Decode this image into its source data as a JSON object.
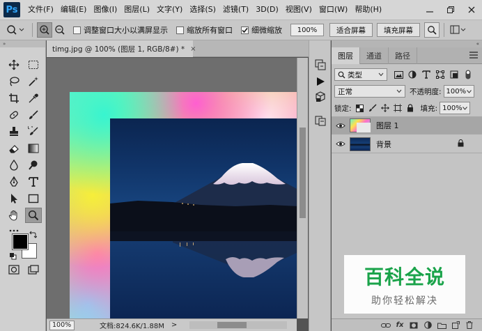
{
  "app": {
    "logo": "Ps"
  },
  "menu": [
    "文件(F)",
    "编辑(E)",
    "图像(I)",
    "图层(L)",
    "文字(Y)",
    "选择(S)",
    "滤镜(T)",
    "3D(D)",
    "视图(V)",
    "窗口(W)",
    "帮助(H)"
  ],
  "window_controls": {
    "minimize": "minimize-icon",
    "restore": "restore-icon",
    "close": "close-icon"
  },
  "options": {
    "resize_windows": "调整窗口大小以满屏显示",
    "zoom_all_windows": "缩放所有窗口",
    "scrubby_zoom": "细微缩放",
    "scrubby_zoom_checked": true,
    "zoom_value": "100%",
    "fit_screen": "适合屏幕",
    "fill_screen": "填充屏幕"
  },
  "document": {
    "tab_title": "timg.jpg @ 100% (图层 1, RGB/8#) *",
    "close_glyph": "×",
    "zoom": "100%",
    "doc_info": "文档:824.6K/1.88M",
    "status_arrow": ">"
  },
  "toolbar": {
    "head": "» ",
    "colors": {
      "foreground": "#000000",
      "background": "#ffffff"
    }
  },
  "panel": {
    "head": "«",
    "tabs": [
      "图层",
      "通道",
      "路径"
    ],
    "active_tab": 0,
    "filter_kind": "类型",
    "blend_mode": "正常",
    "opacity_label": "不透明度:",
    "opacity_value": "100%",
    "lock_label": "锁定:",
    "fill_label": "填充:",
    "fill_value": "100%",
    "layers": [
      {
        "name": "图层 1",
        "selected": true,
        "locked": false
      },
      {
        "name": "背景",
        "selected": false,
        "locked": true
      }
    ],
    "footer_buttons": [
      "link-icon",
      "fx-icon",
      "mask-icon",
      "adjustment-icon",
      "group-icon",
      "new-layer-icon",
      "trash-icon"
    ],
    "footer_fx": "fx"
  },
  "watermark": {
    "title": "百科全说",
    "subtitle": "助你轻松解决"
  }
}
